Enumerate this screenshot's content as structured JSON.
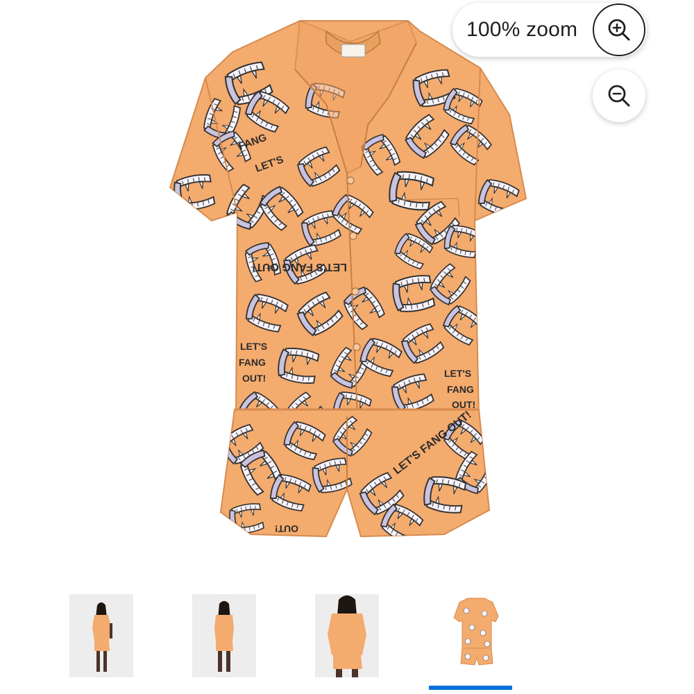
{
  "zoom": {
    "level_label": "100% zoom",
    "zoom_in_icon": "zoom-in-magnifier-icon",
    "zoom_out_icon": "zoom-out-magnifier-icon"
  },
  "product_image": {
    "print_text": "LET'S FANG OUT!",
    "print_words": [
      "LET'S",
      "FANG",
      "OUT!"
    ],
    "colors": {
      "fabric": "#f4ab6e",
      "fabric_shadow": "#e39658",
      "fang_white": "#f7f4fb",
      "fang_lilac": "#c9c3e0",
      "outline": "#333333"
    }
  },
  "thumbnails": {
    "count": 4,
    "selected_index": 3,
    "items": [
      {
        "id": "thumb-1",
        "view": "model-front-angle"
      },
      {
        "id": "thumb-2",
        "view": "model-back"
      },
      {
        "id": "thumb-3",
        "view": "model-front-closeup"
      },
      {
        "id": "thumb-4",
        "view": "product-flat"
      }
    ],
    "indicator_color": "#0071dc"
  }
}
